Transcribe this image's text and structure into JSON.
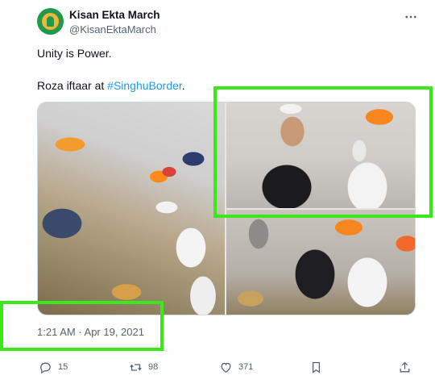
{
  "account": {
    "display_name": "Kisan Ekta March",
    "handle": "@KisanEktaMarch",
    "avatar_icon": "kisan-ekta-logo-icon"
  },
  "post": {
    "line1": "Unity is Power.",
    "line2_prefix": "Roza iftaar at ",
    "hashtag": "#SinghuBorder",
    "line2_suffix": ".",
    "timestamp": "1:21 AM · Apr 19, 2021"
  },
  "media": {
    "photo_count": 3
  },
  "actions": {
    "reply_count": "15",
    "retweet_count": "98",
    "like_count": "371"
  },
  "colors": {
    "highlight": "#3be818",
    "link": "#1d9bf0",
    "muted": "#536471"
  }
}
